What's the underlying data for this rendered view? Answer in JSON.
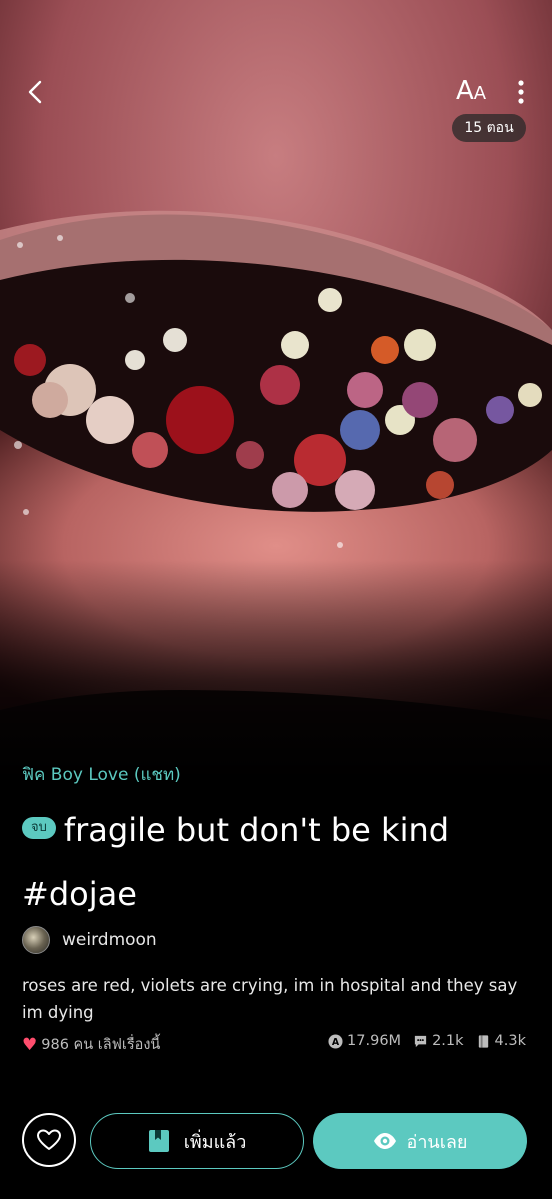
{
  "header": {
    "back_icon": "chevron-left-icon",
    "font_size_label_big": "A",
    "font_size_label_small": "A",
    "more_icon": "vertical-dots-icon",
    "episode_count": "15 ตอน"
  },
  "story": {
    "category": "ฟิค Boy Love (แชท)",
    "status_badge": "จบ",
    "title": "fragile but don't be kind #dojae",
    "author": "weirdmoon",
    "description": "roses are red, violets are crying, im in hospital and they say im dying",
    "likes_text": "986 คน เลิฟเรื่องนี้",
    "views": "17.96M",
    "comments": "2.1k",
    "bookmarks": "4.3k"
  },
  "actions": {
    "like_icon": "heart-outline-icon",
    "library_label": "เพิ่มแล้ว",
    "library_icon": "bookmark-book-icon",
    "read_label": "อ่านเลย",
    "read_icon": "eye-icon"
  },
  "colors": {
    "accent": "#5cc9c0",
    "heart": "#ff4d6d",
    "background": "#000000"
  }
}
